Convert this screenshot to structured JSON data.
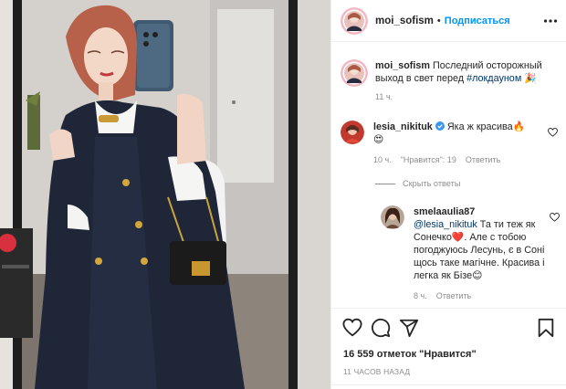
{
  "post": {
    "username": "moi_sofism",
    "separator": "•",
    "follow_label": "Подписаться"
  },
  "caption": {
    "username": "moi_sofism",
    "text": "Последний осторожный выход в свет перед",
    "hashtag": "#локдауном",
    "emoji": "🎉",
    "time": "11 ч."
  },
  "comment1": {
    "username": "lesia_nikituk",
    "text": "Яка ж красива",
    "emoji1": "🔥",
    "emoji2": "😍",
    "time": "10 ч.",
    "likes": "\"Нравится\": 19",
    "reply_label": "Ответить"
  },
  "hide_replies_label": "Скрыть ответы",
  "comment2": {
    "username": "smelaaulia87",
    "mention": "@lesia_nikituk",
    "text1": "Та ти теж як Сонечко",
    "emoji1": "❤️",
    "text2": ". Але с тобою погоджуюсь Лесунь, є в Соні щось таке магічне. Красива і легка як Бізе",
    "emoji2": "😊",
    "time": "8 ч.",
    "reply_label": "Ответить"
  },
  "likes_text": "16 559 отметок \"Нравится\"",
  "timestamp": "11 ЧАСОВ НАЗАД",
  "icons": {
    "more": "more-icon",
    "like": "heart-icon",
    "comment": "comment-icon",
    "share": "share-icon",
    "save": "bookmark-icon",
    "verified": "verified-badge-icon"
  },
  "colors": {
    "link": "#0095f6",
    "hashtag": "#00376b",
    "muted": "#8e8e8e",
    "text": "#262626",
    "verified": "#3897f0"
  }
}
